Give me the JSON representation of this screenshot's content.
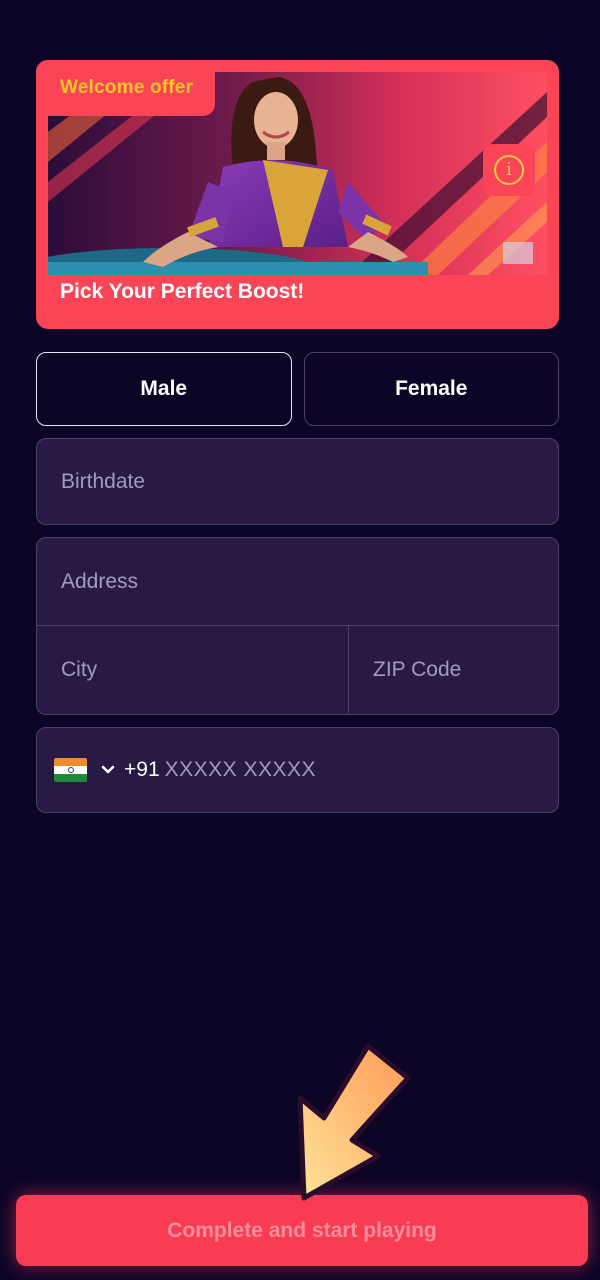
{
  "banner": {
    "badge": "Welcome offer",
    "title": "Pick Your Perfect Boost!",
    "info_icon": "info-icon"
  },
  "gender": {
    "options": [
      "Male",
      "Female"
    ],
    "selected": "Male"
  },
  "form": {
    "birthdate_placeholder": "Birthdate",
    "address_placeholder": "Address",
    "city_placeholder": "City",
    "zip_placeholder": "ZIP Code",
    "phone": {
      "country_flag": "india-flag-icon",
      "dial_code": "+91",
      "placeholder": "XXXXX XXXXX"
    }
  },
  "cta": {
    "label": "Complete and start playing"
  },
  "colors": {
    "background": "#0c0526",
    "accent": "#fb4557",
    "badge_text": "#ffc629",
    "field_bg": "#291a45"
  }
}
